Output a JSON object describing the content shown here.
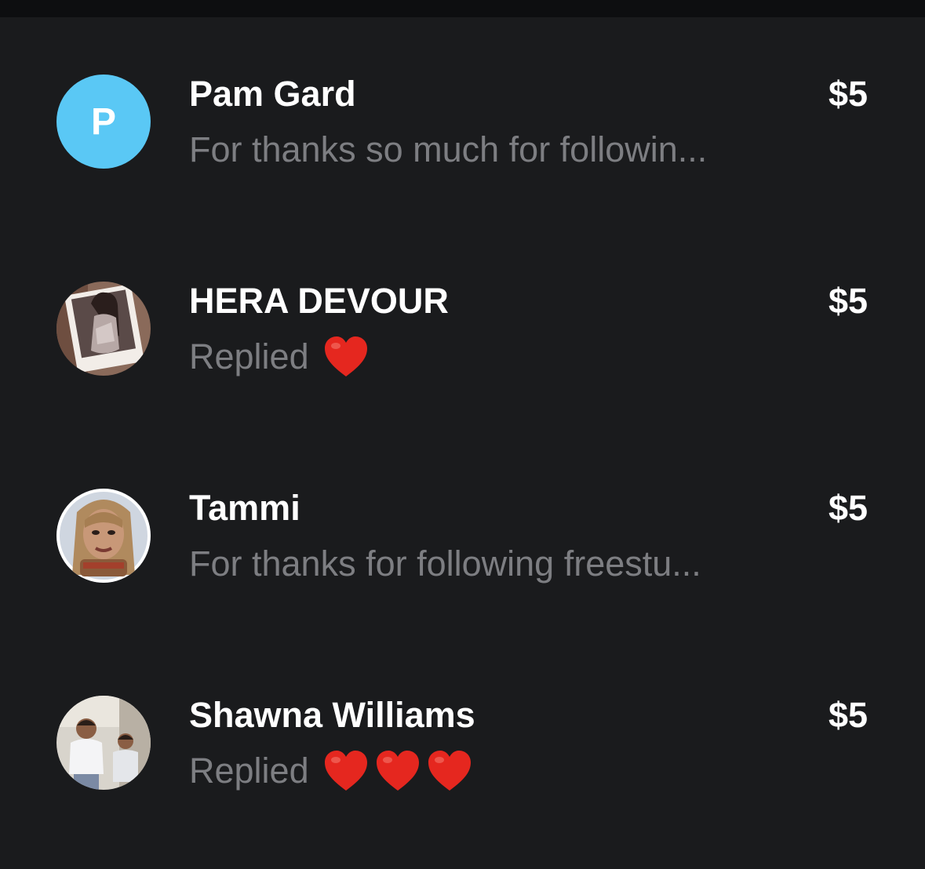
{
  "transactions": [
    {
      "name": "Pam Gard",
      "subtitle": "For thanks so much for followin...",
      "amount": "$5",
      "avatar": {
        "type": "letter",
        "letter": "P",
        "color": "#5ac8f5"
      },
      "hearts": 0
    },
    {
      "name": "HERA DEVOUR",
      "subtitle": "Replied",
      "amount": "$5",
      "avatar": {
        "type": "photo"
      },
      "hearts": 1
    },
    {
      "name": "Tammi",
      "subtitle": "For thanks for following freestu...",
      "amount": "$5",
      "avatar": {
        "type": "photo"
      },
      "hearts": 0
    },
    {
      "name": "Shawna Williams",
      "subtitle": "Replied",
      "amount": "$5",
      "avatar": {
        "type": "photo"
      },
      "hearts": 3
    }
  ],
  "colors": {
    "background": "#1a1b1d",
    "text_primary": "#ffffff",
    "text_secondary": "#7d7e82",
    "heart": "#e5271f"
  },
  "icons": {
    "reply_reaction": "heart-icon"
  }
}
